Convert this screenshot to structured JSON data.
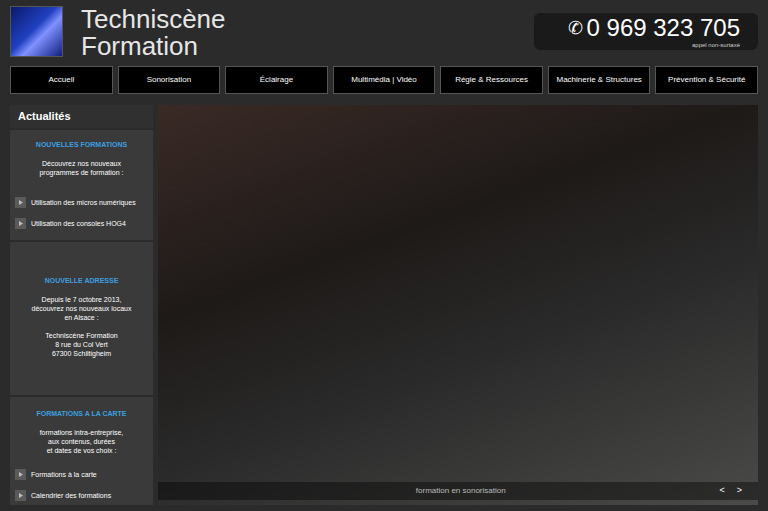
{
  "logo": {
    "line1": "Techniscène",
    "line2": "Formation"
  },
  "phone": {
    "icon": "✆",
    "number": "0 969 323 705",
    "note": "appel non-surtaxé"
  },
  "nav": [
    {
      "label": "Accueil",
      "selected": false
    },
    {
      "label": "Sonorisation",
      "selected": false
    },
    {
      "label": "Éclairage",
      "selected": false
    },
    {
      "label": "Multimédia | Vidéo",
      "selected": false
    },
    {
      "label": "Régie & Ressources",
      "selected": false
    },
    {
      "label": "Machinerie & Structures",
      "selected": false
    },
    {
      "label": "Prévention & Sécurité",
      "selected": false
    }
  ],
  "sidebar": {
    "title": "Actualités",
    "sections": [
      {
        "title": "NOUVELLES FORMATIONS",
        "lines": [
          "Découvrez nos nouveaux",
          "programmes de formation :"
        ],
        "links": [
          "Utilisation des micros numériques",
          "Utilisation des consoles HOG4"
        ]
      },
      {
        "title": "NOUVELLE ADRESSE",
        "lines": [
          "Depuis le 7 octobre 2013,",
          "découvrez nos nouveaux locaux",
          "en Alsace :",
          "",
          "Techniscène Formation",
          "8 rue du Col Vert",
          "67300 Schiltigheim"
        ],
        "links": []
      },
      {
        "title": "FORMATIONS A LA CARTE",
        "lines": [
          "formations intra-entreprise,",
          "aux contenus, durées",
          "et dates de vos choix :"
        ],
        "links": [
          "Formations à la carte",
          "Calendrier des formations"
        ]
      }
    ]
  },
  "slider": {
    "caption": "formation en sonorisation",
    "prev": "<",
    "next": ">"
  }
}
